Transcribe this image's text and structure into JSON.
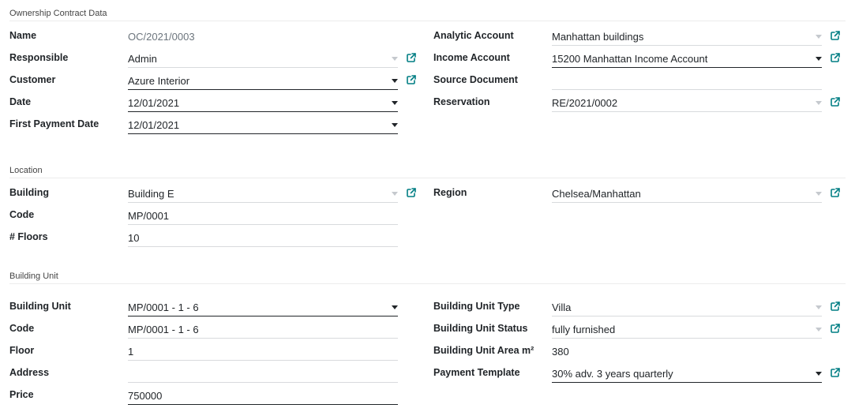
{
  "sections": {
    "ownership": "Ownership Contract Data",
    "location": "Location",
    "unit": "Building Unit"
  },
  "ownership": {
    "name": {
      "label": "Name",
      "value": "OC/2021/0003"
    },
    "responsible": {
      "label": "Responsible",
      "value": "Admin"
    },
    "customer": {
      "label": "Customer",
      "value": "Azure Interior"
    },
    "date": {
      "label": "Date",
      "value": "12/01/2021"
    },
    "first_payment_date": {
      "label": "First Payment Date",
      "value": "12/01/2021"
    },
    "analytic_account": {
      "label": "Analytic Account",
      "value": "Manhattan buildings"
    },
    "income_account": {
      "label": "Income Account",
      "value": "15200 Manhattan Income Account"
    },
    "source_document": {
      "label": "Source Document",
      "value": ""
    },
    "reservation": {
      "label": "Reservation",
      "value": "RE/2021/0002"
    }
  },
  "location": {
    "building": {
      "label": "Building",
      "value": "Building E"
    },
    "code": {
      "label": "Code",
      "value": "MP/0001"
    },
    "floors": {
      "label": "# Floors",
      "value": "10"
    },
    "region": {
      "label": "Region",
      "value": "Chelsea/Manhattan"
    }
  },
  "unit": {
    "building_unit": {
      "label": "Building Unit",
      "value": "MP/0001 - 1 - 6"
    },
    "code": {
      "label": "Code",
      "value": "MP/0001 - 1 - 6"
    },
    "floor": {
      "label": "Floor",
      "value": "1"
    },
    "address": {
      "label": "Address",
      "value": ""
    },
    "price": {
      "label": "Price",
      "value": "750000"
    },
    "unit_type": {
      "label": "Building Unit Type",
      "value": "Villa"
    },
    "unit_status": {
      "label": "Building Unit Status",
      "value": "fully furnished"
    },
    "unit_area": {
      "label": "Building Unit Area m²",
      "value": "380"
    },
    "payment_template": {
      "label": "Payment Template",
      "value": "30% adv. 3 years quarterly"
    }
  },
  "icons": {
    "external_link": "external-link-icon",
    "dropdown": "caret-down-icon"
  },
  "colors": {
    "accent": "#017e84",
    "border": "#d8dadd",
    "text": "#212529"
  }
}
